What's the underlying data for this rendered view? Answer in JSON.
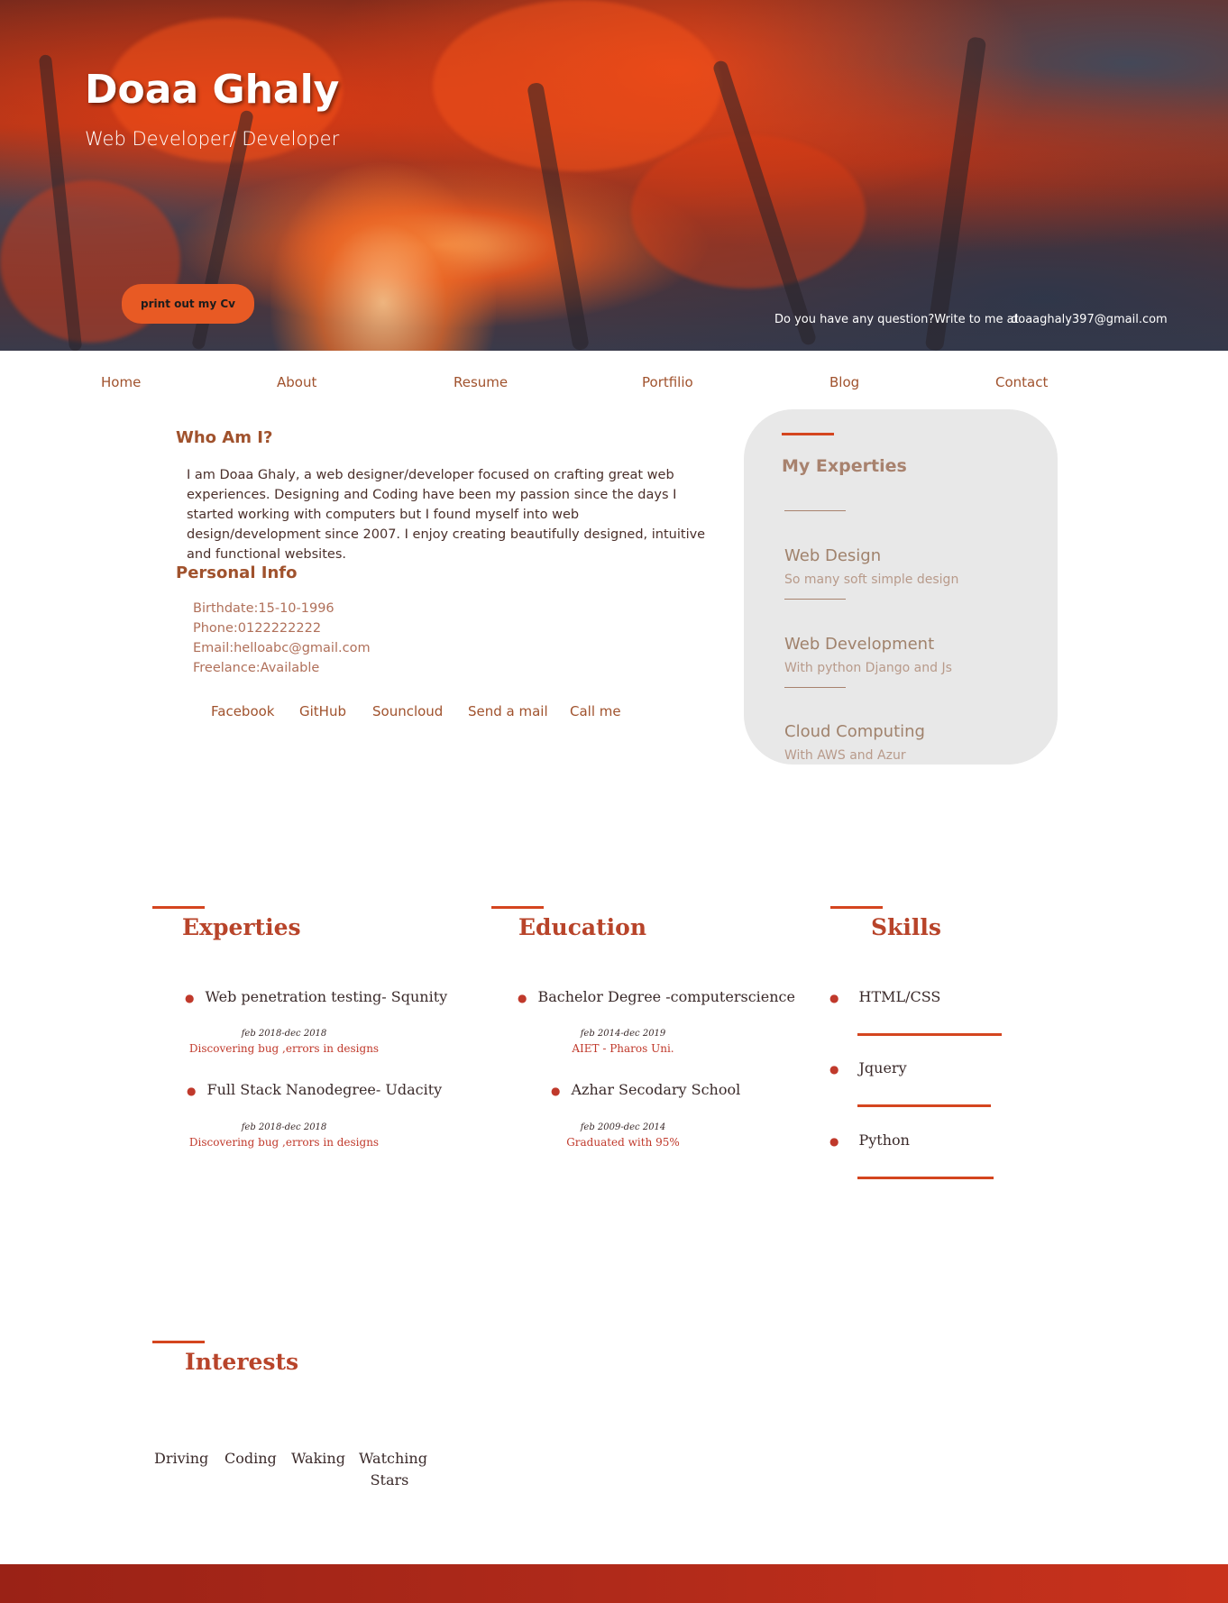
{
  "header": {
    "name": "Doaa Ghaly",
    "subtitle": "Web Developer/ Developer",
    "cv_button": "print out my Cv",
    "question": "Do you have any question?Write to me at",
    "email": "doaaghaly397@gmail.com"
  },
  "nav": {
    "items": [
      "Home",
      "About",
      "Resume",
      "Portfilio",
      "Blog",
      "Contact"
    ]
  },
  "about": {
    "title": "Who Am I?",
    "text": "I am Doaa Ghaly, a web designer/developer focused on crafting great web experiences. Designing and Coding have been my passion since the days I started working with computers but I found myself into web design/development since 2007. I enjoy creating beautifully designed, intuitive and functional websites.",
    "personal_info_title": "Personal Info",
    "personal_info": [
      "Birthdate:15-10-1996",
      "Phone:0122222222",
      "Email:helloabc@gmail.com",
      "Freelance:Available"
    ],
    "social_links": [
      "Facebook",
      "GitHub",
      "Souncloud",
      "Send a mail",
      "Call me"
    ]
  },
  "my_experties": {
    "title": "My Experties",
    "items": [
      {
        "title": "Web Design",
        "subtitle": "So many soft simple design"
      },
      {
        "title": "Web Development",
        "subtitle": "With python Django and Js"
      },
      {
        "title": "Cloud Computing",
        "subtitle": "With AWS and Azur"
      }
    ]
  },
  "resume": {
    "experties": {
      "title": "Experties",
      "items": [
        {
          "title": "Web penetration testing- Squnity",
          "date": "feb 2018-dec 2018",
          "desc": "Discovering bug ,errors in designs"
        },
        {
          "title": "Full Stack Nanodegree- Udacity",
          "date": "feb 2018-dec 2018",
          "desc": "Discovering bug ,errors in designs"
        }
      ]
    },
    "education": {
      "title": "Education",
      "items": [
        {
          "title": "Bachelor Degree -computerscience",
          "date": "feb 2014-dec 2019",
          "desc": "AIET - Pharos Uni."
        },
        {
          "title": "Azhar Secodary School",
          "date": "feb 2009-dec 2014",
          "desc": "Graduated with 95%"
        }
      ]
    },
    "skills": {
      "title": "Skills",
      "items": [
        {
          "name": "HTML/CSS",
          "level": 0.95
        },
        {
          "name": "Jquery",
          "level": 0.88
        },
        {
          "name": "Python",
          "level": 0.9
        }
      ]
    }
  },
  "interests": {
    "title": "Interests",
    "items": [
      "Driving",
      "Coding",
      "Waking",
      "Watching Stars"
    ]
  },
  "colors": {
    "accent": "#d4451f",
    "text_brown": "#a0522d",
    "card_bg": "#e8e8e8",
    "footer": "#b02a1a"
  }
}
